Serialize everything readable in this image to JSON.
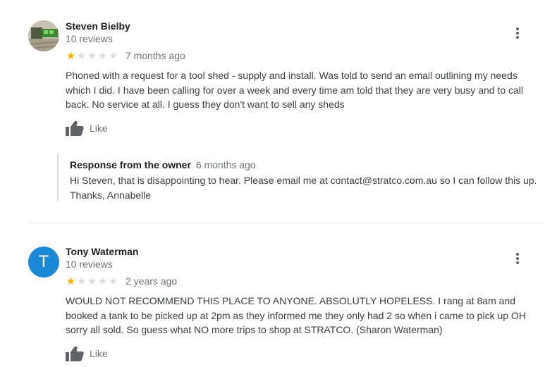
{
  "reviews": [
    {
      "author": "Steven Bielby",
      "review_count": "10 reviews",
      "rating": 1,
      "max_rating": 5,
      "date": "7 months ago",
      "text": "Phoned with a request for a tool shed - supply and install. Was told to send an email outlining my needs which I did. I have been calling for over a week and every time am told that they are very busy and to call back. No service at all. I guess they don't want to sell any sheds",
      "like_label": "Like",
      "avatar": "profile-photo",
      "owner_response": {
        "title": "Response from the owner",
        "date": "6 months ago",
        "text": "Hi Steven, that is disappointing to hear. Please email me at contact@stratco.com.au so I can follow this up. Thanks, Annabelle"
      }
    },
    {
      "author": "Tony Waterman",
      "review_count": "10 reviews",
      "rating": 1,
      "max_rating": 5,
      "date": "2 years ago",
      "text": "WOULD NOT RECOMMEND THIS PLACE TO ANYONE. ABSOLUTLY HOPELESS. I rang at 8am and booked a tank to be picked up at 2pm as they informed me they only had 2 so when i came to pick up OH sorry all sold. So guess what NO more trips to shop at STRATCO. (Sharon Waterman)",
      "like_label": "Like",
      "avatar": "letter",
      "avatar_letter": "T",
      "avatar_color": "#1b88d8"
    }
  ],
  "colors": {
    "star_filled": "#f5b400",
    "star_empty": "#dadce0"
  }
}
